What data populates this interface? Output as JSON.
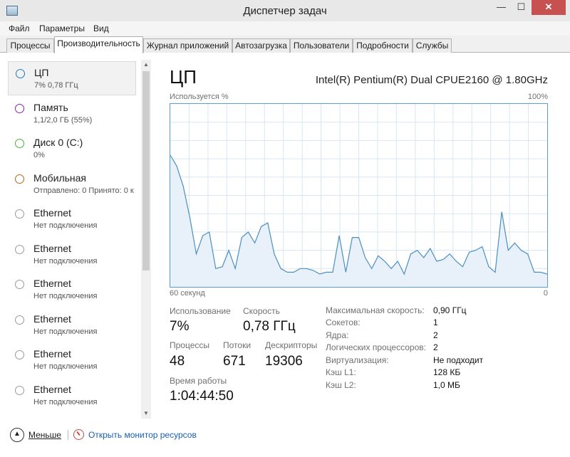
{
  "window": {
    "title": "Диспетчер задач",
    "minimize": "—",
    "maximize": "☐",
    "close": "✕"
  },
  "menu": [
    "Файл",
    "Параметры",
    "Вид"
  ],
  "tabs": [
    "Процессы",
    "Производительность",
    "Журнал приложений",
    "Автозагрузка",
    "Пользователи",
    "Подробности",
    "Службы"
  ],
  "sidebar": [
    {
      "name": "ЦП",
      "sub": "7% 0,78 ГГц",
      "color": "#1a7cc2"
    },
    {
      "name": "Память",
      "sub": "1,1/2,0 ГБ (55%)",
      "color": "#8e24aa"
    },
    {
      "name": "Диск 0 (C:)",
      "sub": "0%",
      "color": "#4caf3c"
    },
    {
      "name": "Мобильная",
      "sub": "Отправлено: 0 Принято: 0 к",
      "color": "#b0661c"
    },
    {
      "name": "Ethernet",
      "sub": "Нет подключения",
      "color": "#9a9a9a"
    },
    {
      "name": "Ethernet",
      "sub": "Нет подключения",
      "color": "#9a9a9a"
    },
    {
      "name": "Ethernet",
      "sub": "Нет подключения",
      "color": "#9a9a9a"
    },
    {
      "name": "Ethernet",
      "sub": "Нет подключения",
      "color": "#9a9a9a"
    },
    {
      "name": "Ethernet",
      "sub": "Нет подключения",
      "color": "#9a9a9a"
    },
    {
      "name": "Ethernet",
      "sub": "Нет подключения",
      "color": "#9a9a9a"
    }
  ],
  "main": {
    "title": "ЦП",
    "cpu_model": "Intel(R) Pentium(R) Dual CPUE2160 @ 1.80GHz",
    "graph": {
      "top_left": "Используется %",
      "top_right": "100%",
      "bottom_left": "60 секунд",
      "bottom_right": "0",
      "line_color": "#4a8fc2",
      "fill_color": "#e8f1f9",
      "grid_color": "#d7e6f2"
    },
    "stats": {
      "usage_label": "Использование",
      "usage": "7%",
      "speed_label": "Скорость",
      "speed": "0,78 ГГц",
      "processes_label": "Процессы",
      "processes": "48",
      "threads_label": "Потоки",
      "threads": "671",
      "handles_label": "Дескрипторы",
      "handles": "19306",
      "uptime_label": "Время работы",
      "uptime": "1:04:44:50"
    },
    "specs": [
      {
        "label": "Максимальная скорость:",
        "value": "0,90 ГГц"
      },
      {
        "label": "Сокетов:",
        "value": "1"
      },
      {
        "label": "Ядра:",
        "value": "2"
      },
      {
        "label": "Логических процессоров:",
        "value": "2"
      },
      {
        "label": "Виртуализация:",
        "value": "Не подходит"
      },
      {
        "label": "Кэш L1:",
        "value": "128 КБ"
      },
      {
        "label": "Кэш L2:",
        "value": "1,0 МБ"
      }
    ]
  },
  "footer": {
    "less": "Меньше",
    "monitor": "Открыть монитор ресурсов"
  },
  "chart_data": {
    "type": "area",
    "series": [
      {
        "values": [
          72,
          66,
          55,
          38,
          18,
          28,
          30,
          10,
          11,
          20,
          10,
          27,
          30,
          24,
          33,
          35,
          18,
          10,
          8,
          8,
          10,
          10,
          9,
          7,
          8,
          8,
          28,
          8,
          27,
          27,
          16,
          10,
          17,
          14,
          10,
          14,
          7,
          18,
          20,
          16,
          21,
          14,
          15,
          18,
          14,
          11,
          19,
          20,
          22,
          11,
          8,
          41,
          20,
          24,
          20,
          18,
          8,
          8,
          7
        ]
      }
    ],
    "ylim": [
      0,
      100
    ],
    "grid": true
  }
}
